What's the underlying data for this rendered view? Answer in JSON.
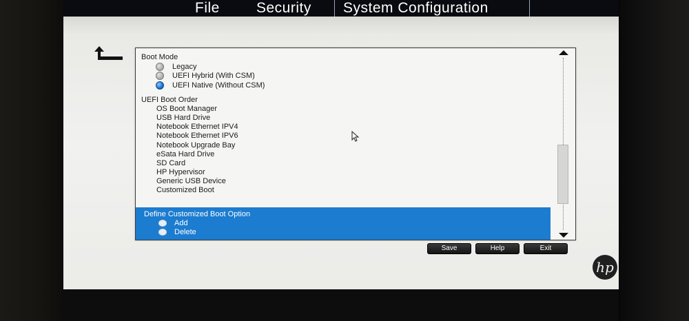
{
  "menu": {
    "tabs": [
      {
        "label": "File",
        "active": false
      },
      {
        "label": "Security",
        "active": false
      },
      {
        "label": "System Configuration",
        "active": true
      }
    ]
  },
  "boot_mode": {
    "heading": "Boot Mode",
    "options": [
      {
        "label": "Legacy",
        "selected": false
      },
      {
        "label": "UEFI Hybrid (With CSM)",
        "selected": false
      },
      {
        "label": "UEFI Native (Without CSM)",
        "selected": true
      }
    ]
  },
  "uefi_boot_order": {
    "heading": "UEFI Boot Order",
    "items": [
      "OS Boot Manager",
      "USB Hard Drive",
      "Notebook Ethernet IPV4",
      "Notebook Ethernet IPV6",
      "Notebook Upgrade Bay",
      "eSata Hard Drive",
      "SD Card",
      "HP Hypervisor",
      "Generic USB Device",
      "Customized Boot"
    ]
  },
  "custom_boot": {
    "heading": "Define Customized Boot Option",
    "options": [
      "Add",
      "Delete"
    ]
  },
  "buttons": {
    "save": "Save",
    "help": "Help",
    "exit": "Exit"
  },
  "brand": {
    "logo_text": "hp"
  },
  "colors": {
    "highlight": "#1c7ccf",
    "selected_radio": "#1d6fcf",
    "menubar": "#0a0b10"
  }
}
